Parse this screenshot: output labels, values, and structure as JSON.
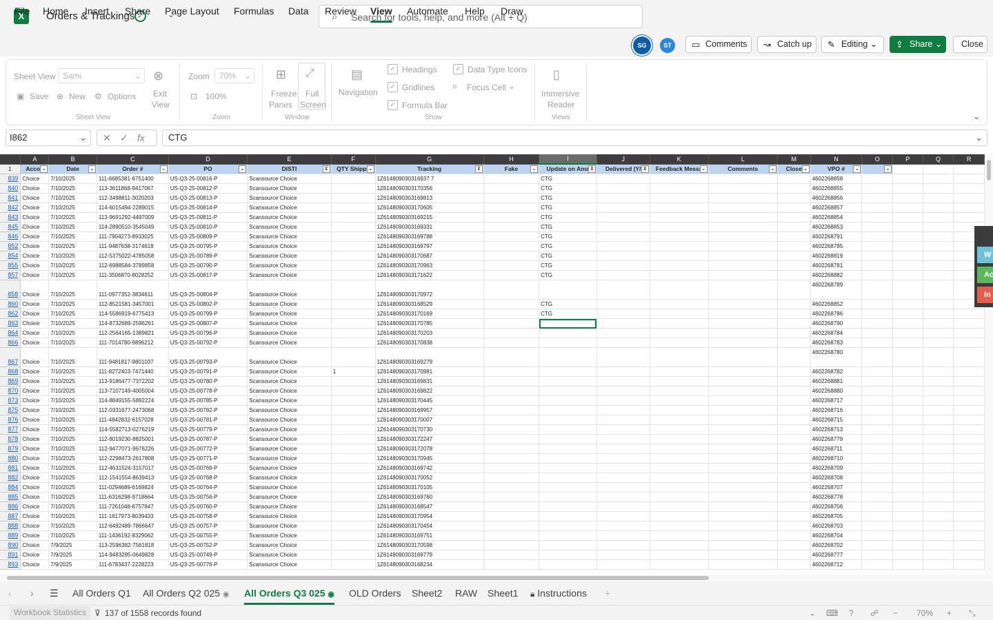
{
  "app": {
    "logo": "X",
    "title": "Orders & Trackings"
  },
  "search": {
    "placeholder": "Search for tools, help, and more (Alt + Q)"
  },
  "menu": [
    "File",
    "Home",
    "Insert",
    "Share",
    "Page Layout",
    "Formulas",
    "Data",
    "Review",
    "View",
    "Automate",
    "Help",
    "Draw"
  ],
  "menu_active": "View",
  "users": [
    "SG",
    "ST"
  ],
  "toolbar": {
    "comments": "Comments",
    "catchup": "Catch up",
    "editing": "Editing",
    "share": "Share",
    "close": "Close"
  },
  "ribbon": {
    "sheet_view_label": "Sheet View",
    "sheet_view_value": "Sami",
    "save": "Save",
    "new": "New",
    "options": "Options",
    "exit_view": [
      "Exit",
      "View"
    ],
    "group_sheet_view": "Sheet View",
    "zoom_label": "Zoom",
    "zoom_value": "70%",
    "zoom_100": "100%",
    "group_zoom": "Zoom",
    "freeze": [
      "Freeze",
      "Panes"
    ],
    "full_screen": [
      "Full",
      "Screen"
    ],
    "group_window": "Window",
    "navigation": "Navigation",
    "headings": "Headings",
    "gridlines": "Gridlines",
    "formula_bar": "Formula Bar",
    "data_type_icons": "Data Type Icons",
    "focus_cell": "Focus Cell",
    "group_show": "Show",
    "immersive": [
      "Immersive",
      "Reader"
    ],
    "group_views": "Views"
  },
  "formula": {
    "cell_ref": "I862",
    "value": "CTG"
  },
  "sheet": {
    "columns": [
      "A",
      "B",
      "C",
      "D",
      "E",
      "F",
      "G",
      "H",
      "I",
      "J",
      "K",
      "L",
      "M",
      "N",
      "O",
      "P",
      "Q",
      "R"
    ],
    "headers": [
      "Accou",
      "Date",
      "Order #",
      "PO",
      "DISTI",
      "QTY Shippe",
      "Tracking",
      "Fake",
      "Update on Ama",
      "Delivered (Y/",
      "Feedback Messa",
      "Comments",
      "Close",
      "VPO #",
      "",
      "",
      "",
      ""
    ],
    "rows": [
      {
        "n": "839",
        "acct": "Choice",
        "date": "7/10/2025",
        "order": "111-6685381-6751400",
        "po": "US-Q3-25-00816-P",
        "disti": "Scansource Choice",
        "qty": "",
        "track": "1Z614809030316937 7",
        "upd": "CTG",
        "vpo": "4602268858"
      },
      {
        "n": "840",
        "acct": "Choice",
        "date": "7/10/2025",
        "order": "113-3611868-9417067",
        "po": "US-Q3-25-00812-P",
        "disti": "Scansource Choice",
        "qty": "",
        "track": "1Z6148090303170356",
        "upd": "CTG",
        "vpo": "4602268855"
      },
      {
        "n": "841",
        "acct": "Choice",
        "date": "7/10/2025",
        "order": "112-3498811-3020203",
        "po": "US-Q3-25-00813-P",
        "disti": "Scansource Choice",
        "qty": "",
        "track": "1Z6148090303169813",
        "upd": "CTG",
        "vpo": "4602268856"
      },
      {
        "n": "842",
        "acct": "Choice",
        "date": "7/10/2025",
        "order": "114-6015494-2289015",
        "po": "US-Q3-25-00814-P",
        "disti": "Scansource Choice",
        "qty": "",
        "track": "1Z6148090303170605",
        "upd": "CTG",
        "vpo": "4602268857"
      },
      {
        "n": "843",
        "acct": "Choice",
        "date": "7/10/2025",
        "order": "113-9691292-4497009",
        "po": "US-Q3-25-00811-P",
        "disti": "Scansource Choice",
        "qty": "",
        "track": "1Z6148090303169215",
        "upd": "CTG",
        "vpo": "4602268854"
      },
      {
        "n": "845",
        "acct": "Choice",
        "date": "7/10/2025",
        "order": "114-2890510-3545049",
        "po": "US-Q3-25-00810-P",
        "disti": "Scansource Choice",
        "qty": "",
        "track": "1Z6148090303169331",
        "upd": "CTG",
        "vpo": "4602268853"
      },
      {
        "n": "846",
        "acct": "Choice",
        "date": "7/10/2025",
        "order": "111-7904273-8933025",
        "po": "US-Q3-25-00809-P",
        "disti": "Scansource Choice",
        "qty": "",
        "track": "1Z6148090303169788",
        "upd": "CTG",
        "vpo": "4602268791"
      },
      {
        "n": "852",
        "acct": "Choice",
        "date": "7/10/2025",
        "order": "111-9487638-3174618",
        "po": "US-Q3-25-00795-P",
        "disti": "Scansource Choice",
        "qty": "",
        "track": "1Z6148090303169797",
        "upd": "CTG",
        "vpo": "4602268785"
      },
      {
        "n": "854",
        "acct": "Choice",
        "date": "7/10/2025",
        "order": "112-5375022-4785058",
        "po": "US-Q3-25-00789-P",
        "disti": "Scansource Choice",
        "qty": "",
        "track": "1Z6148090303170687",
        "upd": "CTG",
        "vpo": "4602268819"
      },
      {
        "n": "855",
        "acct": "Choice",
        "date": "7/10/2025",
        "order": "112-6988584-3789858",
        "po": "US-Q3-25-00790-P",
        "disti": "Scansource Choice",
        "qty": "",
        "track": "1Z6148090303170963",
        "upd": "CTG",
        "vpo": "4602268781"
      },
      {
        "n": "857",
        "acct": "Choice",
        "date": "7/10/2025",
        "order": "111-3506870-8028252",
        "po": "US-Q3-25-00817-P",
        "disti": "Scansource Choice",
        "qty": "",
        "track": "1Z6148090303171622",
        "upd": "CTG",
        "vpo": "4602268882"
      },
      {
        "n": "858",
        "tall": true,
        "acct": "Choice",
        "date": "7/10/2025",
        "order": "111-0977352-3834611",
        "po": "US-Q3-25-00804-P",
        "disti": "Scansource Choice",
        "qty": "",
        "track": "1Z6148090303170972",
        "upd": "CTG",
        "vpo": "4602268789"
      },
      {
        "n": "860",
        "acct": "Choice",
        "date": "7/10/2025",
        "order": "112-8521581-3457001",
        "po": "US-Q3-25-00802-P",
        "disti": "Scansource Choice",
        "qty": "",
        "track": "1Z6148090303168529",
        "upd": "CTG",
        "vpo": "4602268852"
      },
      {
        "n": "862",
        "acct": "Choice",
        "date": "7/10/2025",
        "order": "114-5586919-6775413",
        "po": "US-Q3-25-00799-P",
        "disti": "Scansource Choice",
        "qty": "",
        "track": "1Z6148090303170169",
        "upd": "CTG",
        "vpo": "4602268786"
      },
      {
        "n": "863",
        "acct": "Choice",
        "date": "7/10/2025",
        "order": "114-8732689-2596261",
        "po": "US-Q3-25-00807-P",
        "disti": "Scansource Choice",
        "qty": "",
        "track": "1Z6148090303170785",
        "upd": "",
        "vpo": "4602268790"
      },
      {
        "n": "864",
        "acct": "Choice",
        "date": "7/10/2025",
        "order": "112-2564165-1389821",
        "po": "US-Q3-25-00796-P",
        "disti": "Scansource Choice",
        "qty": "",
        "track": "1Z6148090303170203",
        "upd": "",
        "vpo": "4602268784"
      },
      {
        "n": "866",
        "acct": "Choice",
        "date": "7/10/2025",
        "order": "111-7014780-9896212",
        "po": "US-Q3-25-00792-P",
        "disti": "Scansource Choice",
        "qty": "",
        "track": "1Z6148090303170838",
        "upd": "",
        "vpo": "4602268783"
      },
      {
        "n": "867",
        "tall": true,
        "acct": "Choice",
        "date": "7/10/2025",
        "order": "111-9481817-9801037",
        "po": "US-Q3-25-00793-P",
        "disti": "Scansource Choice",
        "qty": "",
        "track": "1Z6148090303169279",
        "upd": "",
        "vpo": "4602268780"
      },
      {
        "n": "868",
        "acct": "Choice",
        "date": "7/10/2025",
        "order": "111-8272403-7471440",
        "po": "US-Q3-25-00791-P",
        "disti": "Scansource Choice",
        "qty": "1",
        "track": "1Z6148090303170981",
        "upd": "",
        "vpo": "4602268782"
      },
      {
        "n": "869",
        "acct": "Choice",
        "date": "7/10/2025",
        "order": "113-9186477-7372202",
        "po": "US-Q3-25-00780-P",
        "disti": "Scansource Choice",
        "qty": "",
        "track": "1Z6148090303169831",
        "upd": "",
        "vpo": "4602268881"
      },
      {
        "n": "870",
        "acct": "Choice",
        "date": "7/10/2025",
        "order": "113-7107149-4005004",
        "po": "US-Q3-25-00778-P",
        "disti": "Scansource Choice",
        "qty": "",
        "track": "1Z6148090303169822",
        "upd": "",
        "vpo": "4602268880"
      },
      {
        "n": "873",
        "acct": "Choice",
        "date": "7/10/2025",
        "order": "114-8849155-5892224",
        "po": "US-Q3-25-00785-P",
        "disti": "Scansource Choice",
        "qty": "",
        "track": "1Z6148090303170445",
        "upd": "",
        "vpo": "4602268717"
      },
      {
        "n": "875",
        "acct": "Choice",
        "date": "7/10/2025",
        "order": "112-0331677-2473068",
        "po": "US-Q3-25-00782-P",
        "disti": "Scansource Choice",
        "qty": "",
        "track": "1Z6148090303169957",
        "upd": "",
        "vpo": "4602268716"
      },
      {
        "n": "876",
        "acct": "Choice",
        "date": "7/10/2025",
        "order": "111-4842832-6157028",
        "po": "US-Q3-25-00781-P",
        "disti": "Scansource Choice",
        "qty": "",
        "track": "1Z6148090303170007",
        "upd": "",
        "vpo": "4602268715"
      },
      {
        "n": "877",
        "acct": "Choice",
        "date": "7/10/2025",
        "order": "114-5582713-0276219",
        "po": "US-Q3-25-00779-P",
        "disti": "Scansource Choice",
        "qty": "",
        "track": "1Z6148090303170730",
        "upd": "",
        "vpo": "4602268713"
      },
      {
        "n": "878",
        "acct": "Choice",
        "date": "7/10/2025",
        "order": "112-8019230-8825001",
        "po": "US-Q3-25-00787-P",
        "disti": "Scansource Choice",
        "qty": "",
        "track": "1Z6148090303172247",
        "upd": "",
        "vpo": "4602268779"
      },
      {
        "n": "879",
        "acct": "Choice",
        "date": "7/10/2025",
        "order": "112-9477071-9676226",
        "po": "US-Q3-25-00772-P",
        "disti": "Scansource Choice",
        "qty": "",
        "track": "1Z6148090303172078",
        "upd": "",
        "vpo": "4602268711"
      },
      {
        "n": "880",
        "acct": "Choice",
        "date": "7/10/2025",
        "order": "112-2298473-2617808",
        "po": "US-Q3-25-00771-P",
        "disti": "Scansource Choice",
        "qty": "",
        "track": "1Z6148090303170945",
        "upd": "",
        "vpo": "4602268710"
      },
      {
        "n": "881",
        "acct": "Choice",
        "date": "7/10/2025",
        "order": "112-4631524-3157017",
        "po": "US-Q3-25-00769-P",
        "disti": "Scansource Choice",
        "qty": "",
        "track": "1Z6148090303169742",
        "upd": "",
        "vpo": "4602268709"
      },
      {
        "n": "882",
        "acct": "Choice",
        "date": "7/10/2025",
        "order": "112-1541554-8639413",
        "po": "US-Q3-25-00768-P",
        "disti": "Scansource Choice",
        "qty": "",
        "track": "1Z6148090303170052",
        "upd": "",
        "vpo": "4602268708"
      },
      {
        "n": "884",
        "acct": "Choice",
        "date": "7/10/2025",
        "order": "111-0294689-6169824",
        "po": "US-Q3-25-00764-P",
        "disti": "Scansource Choice",
        "qty": "",
        "track": "1Z6148090303170105",
        "upd": "",
        "vpo": "4602268707"
      },
      {
        "n": "885",
        "acct": "Choice",
        "date": "7/10/2025",
        "order": "111-6316298-9718664",
        "po": "US-Q3-25-00756-P",
        "disti": "Scansource Choice",
        "qty": "",
        "track": "1Z6148090303169760",
        "upd": "",
        "vpo": "4602268778"
      },
      {
        "n": "886",
        "acct": "Choice",
        "date": "7/10/2025",
        "order": "111-7261046-6757847",
        "po": "US-Q3-25-00760-P",
        "disti": "Scansource Choice",
        "qty": "",
        "track": "1Z6148090303168547",
        "upd": "",
        "vpo": "4602268706"
      },
      {
        "n": "887",
        "acct": "Choice",
        "date": "7/10/2025",
        "order": "111-1617973-8039433",
        "po": "US-Q3-25-00758-P",
        "disti": "Scansource Choice",
        "qty": "",
        "track": "1Z6148090303170954",
        "upd": "",
        "vpo": "4602268705"
      },
      {
        "n": "888",
        "acct": "Choice",
        "date": "7/10/2025",
        "order": "112-6492489-7866647",
        "po": "US-Q3-25-00757-P",
        "disti": "Scansource Choice",
        "qty": "",
        "track": "1Z6148090303170454",
        "upd": "",
        "vpo": "4602268703"
      },
      {
        "n": "889",
        "acct": "Choice",
        "date": "7/10/2025",
        "order": "111-1436192-8329062",
        "po": "US-Q3-25-00755-P",
        "disti": "Scansource Choice",
        "qty": "",
        "track": "1Z6148090303169751",
        "upd": "",
        "vpo": "4602268704"
      },
      {
        "n": "890",
        "acct": "Choice",
        "date": "7/9/2025",
        "order": "113-2596382-7561818",
        "po": "US-Q3-25-00752-P",
        "disti": "Scansource Choice",
        "qty": "",
        "track": "1Z6148090303170598",
        "upd": "",
        "vpo": "4602268702"
      },
      {
        "n": "891",
        "acct": "Choice",
        "date": "7/9/2025",
        "order": "114-9483295-0649828",
        "po": "US-Q3-25-00749-P",
        "disti": "Scansource Choice",
        "qty": "",
        "track": "1Z6148090303169779",
        "upd": "",
        "vpo": "4602268777"
      },
      {
        "n": "893",
        "acct": "Choice",
        "date": "7/9/2025",
        "order": "111-6783437-2228223",
        "po": "US-Q3-25-00776-P",
        "disti": "Scansource Choice",
        "qty": "",
        "track": "1Z6148090303168234",
        "upd": "",
        "vpo": "4602268712"
      }
    ]
  },
  "side_panel": [
    "W",
    "Ac",
    "In"
  ],
  "side_colors": [
    "#6fc2d8",
    "#5cb85c",
    "#e06050"
  ],
  "tabs": [
    "All Orders Q1",
    "All Orders Q2 025",
    "All Orders Q3 025",
    "OLD Orders",
    "Sheet2",
    "RAW",
    "Sheet1",
    "Instructions"
  ],
  "tab_active": "All Orders Q3 025",
  "status": {
    "workbook_stats": "Workbook Statistics",
    "records": "137 of 1558 records found",
    "zoom": "70%"
  },
  "colors": {
    "accent": "#107c41",
    "header_fill": "#bcd4ee"
  }
}
